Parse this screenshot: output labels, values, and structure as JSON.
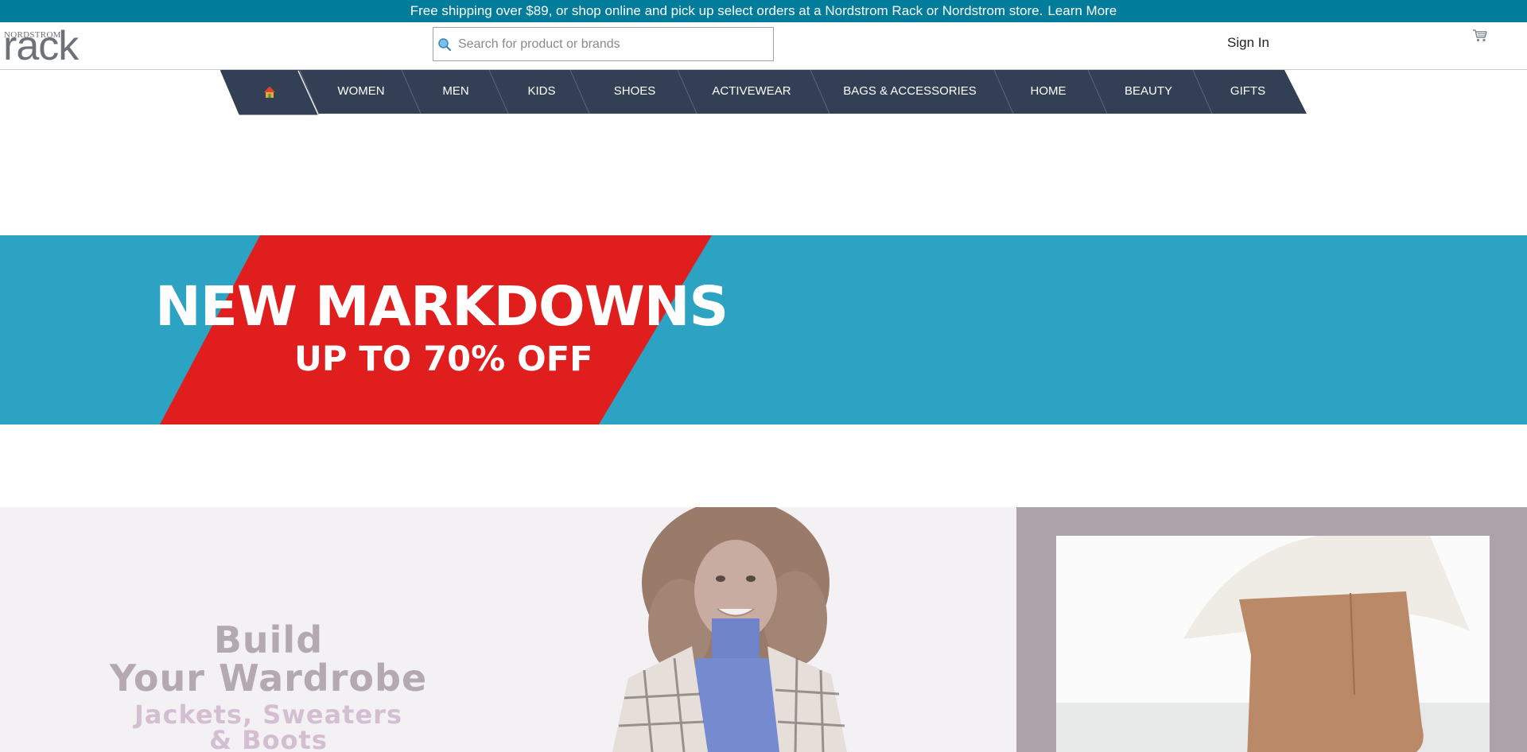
{
  "promo": {
    "text": "Free shipping over $89, or shop online and pick up select orders at a Nordstrom Rack or Nordstrom store.",
    "link": "Learn More"
  },
  "logo": {
    "small": "NORDSTROM",
    "big": "rack"
  },
  "search": {
    "placeholder": "Search for product or brands",
    "value": ""
  },
  "header": {
    "sign_in": "Sign In"
  },
  "nav": {
    "home_icon": "home-icon",
    "items": [
      {
        "label": "WOMEN"
      },
      {
        "label": "MEN"
      },
      {
        "label": "KIDS"
      },
      {
        "label": "SHOES"
      },
      {
        "label": "ACTIVEWEAR"
      },
      {
        "label": "BAGS & ACCESSORIES"
      },
      {
        "label": "HOME"
      },
      {
        "label": "BEAUTY"
      },
      {
        "label": "GIFTS"
      }
    ]
  },
  "banner": {
    "title": "NEW MARKDOWNS",
    "subtitle": "UP TO 70% OFF"
  },
  "hero": {
    "line1": "Build",
    "line2": "Your Wardrobe",
    "sub1": "Jackets, Sweaters",
    "sub2": "& Boots"
  },
  "colors": {
    "promo_bg": "#017c9a",
    "nav_bg": "#333f54",
    "banner_bg": "#2da3c3",
    "banner_red": "#e01e1e",
    "hero_bg": "#f3f1f4",
    "side_bg": "#ada2a9"
  }
}
